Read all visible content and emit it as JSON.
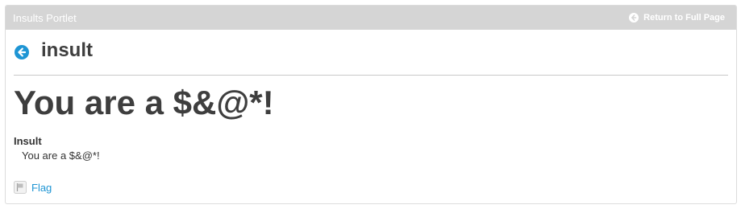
{
  "portlet": {
    "title": "Insults Portlet",
    "return_label": "Return to Full Page"
  },
  "header": {
    "title": "insult"
  },
  "entry": {
    "heading": "You are a $&@*!",
    "field_label": "Insult",
    "field_value": "You are a $&@*!"
  },
  "actions": {
    "flag_label": "Flag"
  },
  "colors": {
    "topper_bg": "#d5d5d5",
    "accent_blue": "#1e95d4",
    "text_dark": "#3e3e3e"
  },
  "icons": {
    "back": "arrow-left-circle-icon",
    "return": "arrow-left-circle-icon",
    "flag": "flag-icon"
  }
}
